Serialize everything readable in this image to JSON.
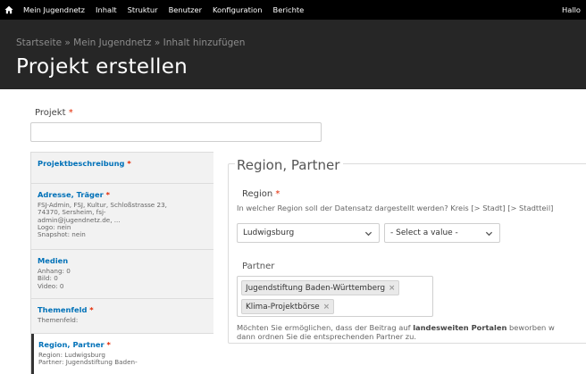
{
  "toolbar": {
    "home_icon": "home-icon",
    "items": [
      "Mein Jugendnetz",
      "Inhalt",
      "Struktur",
      "Benutzer",
      "Konfiguration",
      "Berichte"
    ],
    "greeting": "Hallo"
  },
  "header": {
    "breadcrumb": "Startseite » Mein Jugendnetz » Inhalt hinzufügen",
    "title": "Projekt erstellen"
  },
  "projekt": {
    "label": "Projekt",
    "required": "*",
    "value": ""
  },
  "vtabs": [
    {
      "title": "Projektbeschreibung",
      "required": "*",
      "summary": []
    },
    {
      "title": "Adresse, Träger",
      "required": "*",
      "summary": [
        "FSJ-Admin, FSJ, Kultur, Schloßstrasse 23,",
        "74370, Sersheim, fsj-",
        "admin@jugendnetz.de, ...",
        "Logo: nein",
        "Snapshot: nein"
      ]
    },
    {
      "title": "Medien",
      "required": "",
      "summary": [
        "Anhang: 0",
        "Bild: 0",
        "Video: 0"
      ]
    },
    {
      "title": "Themenfeld",
      "required": "*",
      "summary": [
        "Themenfeld:"
      ]
    },
    {
      "title": "Region, Partner",
      "required": "*",
      "summary": [
        "Region: Ludwigsburg",
        "Partner: Jugendstiftung Baden-"
      ]
    }
  ],
  "fieldset": {
    "legend": "Region, Partner",
    "region_label": "Region",
    "region_required": "*",
    "region_description": "In welcher Region soll der Datensatz dargestellt werden? Kreis [> Stadt] [> Stadtteil]",
    "region_select_1": "Ludwigsburg",
    "region_select_2": "- Select a value -",
    "partner_label": "Partner",
    "partners": [
      "Jugendstiftung Baden-Württemberg",
      "Klima-Projektbörse"
    ],
    "chip_remove": "×",
    "help_part1": "Möchten Sie ermöglichen, dass der Beitrag auf ",
    "help_bold": "landesweiten Portalen",
    "help_part2": " beworben w",
    "help_line2": "dann ordnen Sie die entsprechenden Partner zu."
  },
  "colors": {
    "toolbar_bg": "#000000",
    "header_bg": "#262626",
    "link": "#0071b8",
    "required": "#e32700"
  }
}
